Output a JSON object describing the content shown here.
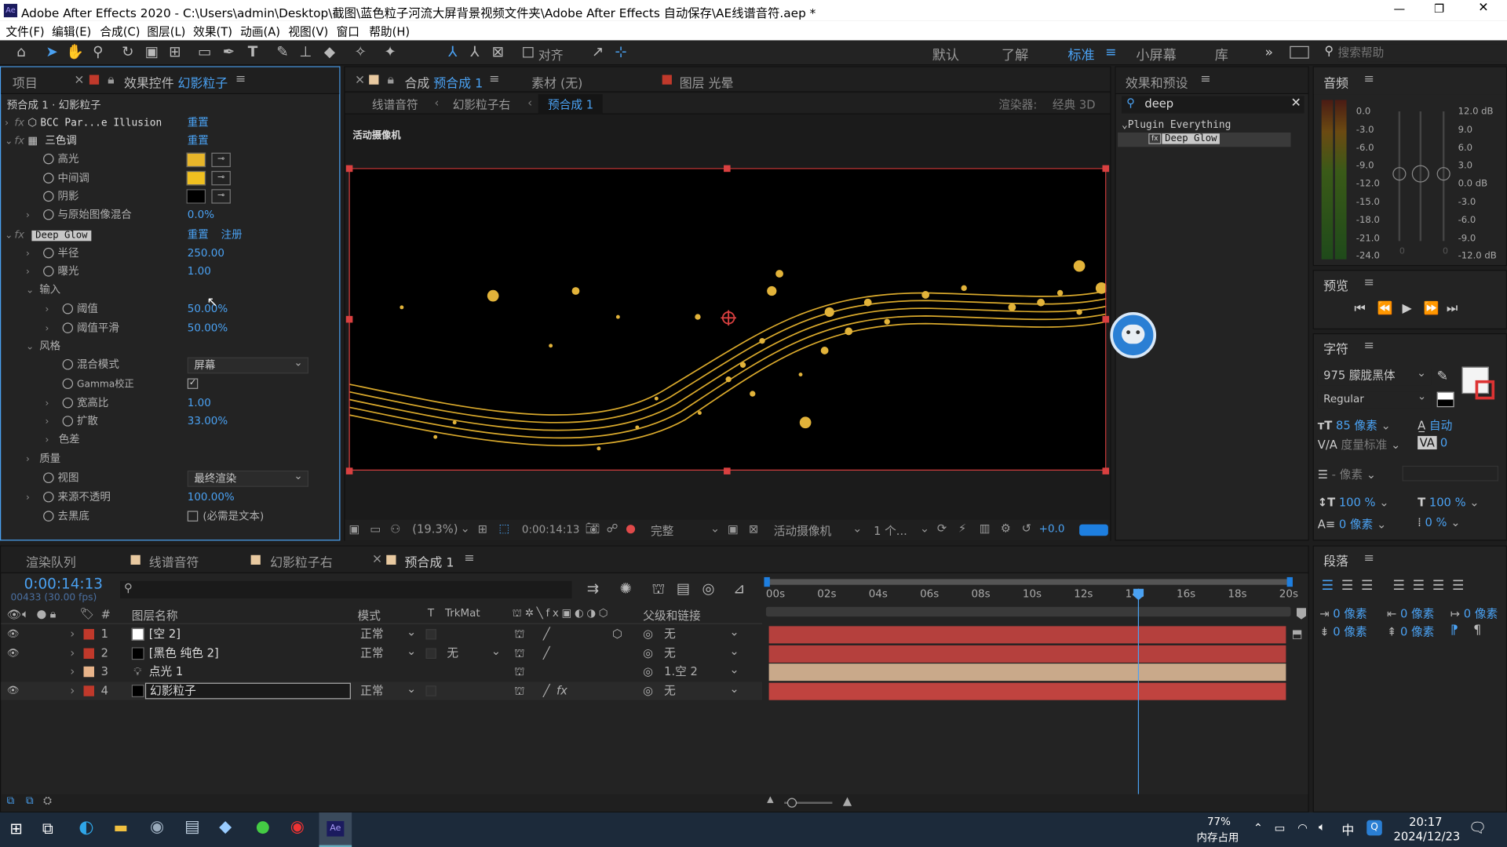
{
  "window": {
    "title": "Adobe After Effects 2020 - C:\\Users\\admin\\Desktop\\截图\\蓝色粒子河流大屏背景视频文件夹\\Adobe After Effects 自动保存\\AE线谱音符.aep *",
    "app_badge": "Ae",
    "minimize": "—",
    "maximize": "❐",
    "close": "✕"
  },
  "menu": [
    "文件(F)",
    "编辑(E)",
    "合成(C)",
    "图层(L)",
    "效果(T)",
    "动画(A)",
    "视图(V)",
    "窗口",
    "帮助(H)"
  ],
  "toolbar": {
    "align": "对齐",
    "workspaces": [
      "默认",
      "了解",
      "标准",
      "小屏幕",
      "库"
    ],
    "active_workspace": "标准",
    "more": "»",
    "search_placeholder": "搜索帮助"
  },
  "effects_panel": {
    "tab_project": "项目",
    "tab_effects": "效果控件",
    "tab_layer": "幻影粒子",
    "breadcrumb": "预合成 1 · 幻影粒子",
    "fx1_name": "BCC Par...e Illusion",
    "fx1_reset": "重置",
    "fx2_name": "三色调",
    "fx2_reset": "重置",
    "highlight": "高光",
    "midtone": "中间调",
    "shadow": "阴影",
    "blend": "与原始图像混合",
    "blend_val": "0.0%",
    "fx3_name": "Deep Glow",
    "fx3_reset": "重置",
    "fx3_register": "注册",
    "radius": "半径",
    "radius_val": "250.00",
    "exposure": "曝光",
    "exposure_val": "1.00",
    "input_group": "输入",
    "threshold": "阈值",
    "threshold_val": "50.00%",
    "threshold_smooth": "阈值平滑",
    "threshold_smooth_val": "50.00%",
    "style_group": "风格",
    "blend_mode": "混合模式",
    "blend_mode_val": "屏幕",
    "gamma": "Gamma校正",
    "aspect": "宽高比",
    "aspect_val": "1.00",
    "spread": "扩散",
    "spread_val": "33.00%",
    "chroma": "色差",
    "quality": "质量",
    "view": "视图",
    "view_val": "最终渲染",
    "source_opacity": "来源不透明",
    "source_opacity_val": "100.00%",
    "unmult": "去黑底",
    "unmult_note": "(必需是文本)",
    "colors": {
      "highlight": "#e8b62a",
      "midtone": "#f0c020",
      "shadow": "#000000"
    }
  },
  "comp_panel": {
    "tab_prefix": "合成",
    "tab_comp": "预合成 1",
    "tab_footage": "素材 (无)",
    "tab_layer": "图层 光晕",
    "crumbs": [
      "线谱音符",
      "幻影粒子右",
      "预合成 1"
    ],
    "renderer": "渲染器:",
    "renderer_val": "经典 3D",
    "camera_label": "活动摄像机",
    "zoom": "(19.3%)",
    "time": "0:00:14:13",
    "quality": "完整",
    "view_camera": "活动摄像机",
    "views": "1 个...",
    "exposure": "+0.0"
  },
  "effects_presets": {
    "title": "效果和预设",
    "search": "deep",
    "category": "Plugin Everything",
    "item": "Deep Glow"
  },
  "audio": {
    "title": "音频",
    "left_scale": [
      "0.0",
      "-3.0",
      "-6.0",
      "-9.0",
      "-12.0",
      "-15.0",
      "-18.0",
      "-21.0",
      "-24.0"
    ],
    "right_scale": [
      "12.0 dB",
      "9.0",
      "6.0",
      "3.0",
      "0.0 dB",
      "-3.0",
      "-6.0",
      "-9.0",
      "-12.0 dB"
    ],
    "bottom": [
      "0",
      "0"
    ]
  },
  "preview": {
    "title": "预览"
  },
  "character": {
    "title": "字符",
    "font": "975 朦胧黑体",
    "style": "Regular",
    "size": "85 像素",
    "leading": "自动",
    "kerning": "度量标准",
    "tracking": "0",
    "stroke": "- 像素",
    "vscale": "100 %",
    "hscale": "100 %",
    "baseline": "0 像素",
    "tsume": "0 %"
  },
  "paragraph": {
    "title": "段落",
    "indent1": "0 像素",
    "indent2": "0 像素",
    "indent3": "0 像素",
    "space1": "0 像素",
    "space2": "0 像素"
  },
  "timeline": {
    "tabs": [
      "渲染队列",
      "线谱音符",
      "幻影粒子右",
      "预合成 1"
    ],
    "timecode": "0:00:14:13",
    "frames": "00433 (30.00 fps)",
    "cols": {
      "num": "#",
      "name": "图层名称",
      "mode": "模式",
      "t": "T",
      "trkmat": "TrkMat",
      "parent": "父级和链接"
    },
    "ruler": [
      "00s",
      "02s",
      "04s",
      "06s",
      "08s",
      "10s",
      "12s",
      "14s",
      "16s",
      "18s",
      "20s"
    ],
    "current_time_s": 14.43,
    "duration_s": 20,
    "layers": [
      {
        "num": "1",
        "name": "[空 2]",
        "mode": "正常",
        "trkmat": "",
        "parent": "无",
        "label": "#c0392b",
        "thumb": "#ffffff",
        "bar": "#b5403d"
      },
      {
        "num": "2",
        "name": "[黑色 纯色 2]",
        "mode": "正常",
        "trkmat": "无",
        "parent": "无",
        "label": "#c0392b",
        "thumb": "#000000",
        "bar": "#b5403d"
      },
      {
        "num": "3",
        "name": "点光 1",
        "mode": "",
        "trkmat": "",
        "parent": "1.空 2",
        "label": "#e8b48a",
        "thumb": "",
        "bar": "#c9a98a"
      },
      {
        "num": "4",
        "name": "幻影粒子",
        "mode": "正常",
        "trkmat": "",
        "parent": "无",
        "label": "#c0392b",
        "thumb": "#000000",
        "bar": "#c0433f"
      }
    ]
  },
  "taskbar": {
    "memory_pct": "77%",
    "memory_label": "内存占用",
    "ime": "中",
    "time": "20:17",
    "date": "2024/12/23"
  }
}
